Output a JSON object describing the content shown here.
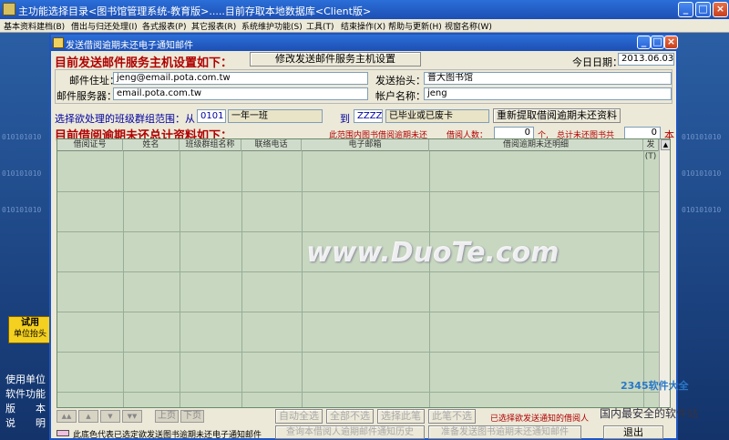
{
  "outer": {
    "title": "主功能选择目录<图书馆管理系统-教育版>.....目前存取本地数据库<Client版>",
    "menu": [
      "基本资料建档(B)",
      "借出与归还处理(I)",
      "各式报表(P)",
      "其它报表(R)",
      "系统维护功能(S)",
      "工具(T)",
      "结束操作(X)",
      "帮助与更新(H)",
      "视窗名称(W)"
    ],
    "binary_text": "010101010",
    "trial_badge": [
      "试用",
      "单位抬头"
    ],
    "left_info": [
      "使用单位",
      "软件功能",
      "版　　本",
      "说　　明"
    ]
  },
  "dialog": {
    "title": "发送借阅逾期未还电子通知邮件",
    "heading": "目前发送邮件服务主机设置如下：",
    "modify_button": "修改发送邮件服务主机设置",
    "today_label": "今日日期：",
    "today_value": "2013.06.03",
    "mail_address_label": "邮件住址：",
    "mail_address_value": "jeng@email.pota.com.tw",
    "mail_server_label": "邮件服务器：",
    "mail_server_value": "email.pota.com.tw",
    "sender_header_label": "发送抬头：",
    "sender_header_value": "普大图书馆",
    "account_label": "帐户名称：",
    "account_value": "jeng",
    "range_label": "选择欲处理的班级群组范围：从",
    "range_from_code": "0101",
    "range_from_name": "一年一班",
    "range_to_label": "到",
    "range_to_code": "ZZZZ",
    "range_to_name": "已毕业或已废卡",
    "refresh_button": "重新提取借阅逾期未还资料",
    "stats_heading": "目前借阅逾期未还总计资料如下：",
    "stats_label": "此范围内图书借阅逾期未还",
    "borrower_label": "借阅人数：",
    "borrower_count": "0",
    "unit_persons": "个,",
    "total_label": "总计未还图书共",
    "total_count": "0",
    "unit_books": "本",
    "columns": [
      "借阅证号",
      "姓名",
      "班级群组名称",
      "联络电话",
      "电子邮箱",
      "借阅逾期未还明细",
      "发(T)"
    ],
    "nav_buttons": [
      "▲▲",
      "▲",
      "▼",
      "▼▼",
      "上页",
      "下页"
    ],
    "action_buttons": [
      "自动全选",
      "全部不选",
      "选择此笔",
      "此笔不选"
    ],
    "selected_status": "已选择欲发送通知的借阅人",
    "legend_text": "此底色代表已选定欲发送图书逾期未还电子通知邮件",
    "history_button": "查询本借阅人逾期邮件通知历史",
    "send_button": "准备发送图书逾期未还通知邮件",
    "exit_button": "退出"
  },
  "watermark": {
    "text": "www.DuoTe.com",
    "brand": "2345软件大全",
    "tagline": "国内最安全的软件站"
  },
  "colors": {
    "titlebar": "#1d4fb4",
    "heading_red": "#b00000",
    "grid": "#c8d8c0"
  }
}
